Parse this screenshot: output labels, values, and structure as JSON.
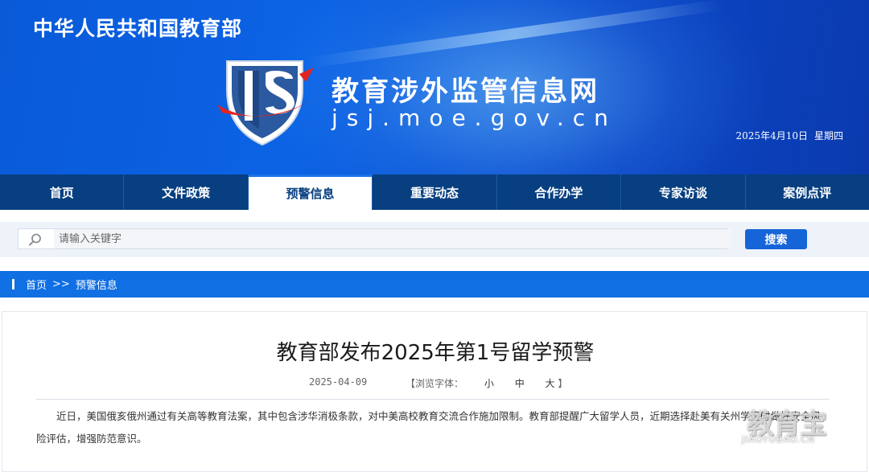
{
  "header": {
    "ministry": "中华人民共和国教育部",
    "site_title": "教育涉外监管信息网",
    "site_domain": "jsj.moe.gov.cn",
    "date": "2025年4月10日",
    "weekday": "星期四"
  },
  "nav": {
    "items": [
      {
        "label": "首页"
      },
      {
        "label": "文件政策"
      },
      {
        "label": "预警信息",
        "active": true
      },
      {
        "label": "重要动态"
      },
      {
        "label": "合作办学"
      },
      {
        "label": "专家访谈"
      },
      {
        "label": "案例点评"
      }
    ]
  },
  "search": {
    "placeholder": "请输入关键字",
    "value": "",
    "button_label": "搜索"
  },
  "breadcrumb": {
    "home": "首页",
    "separator": ">>",
    "current": "预警信息"
  },
  "article": {
    "title": "教育部发布2025年第1号留学预警",
    "date": "2025-04-09",
    "font_size_label": "【浏览字体：",
    "font_sizes": [
      "小",
      "中",
      "大"
    ],
    "font_size_close": "】",
    "body": "近日，美国俄亥俄州通过有关高等教育法案，其中包含涉华消极条款，对中美高校教育交流合作施加限制。教育部提醒广大留学人员，近期选择赴美有关州学习时做好安全风险评估，增强防范意识。"
  },
  "watermark": {
    "cn": "教育宝",
    "en": "JIAOYUBAO.CN"
  },
  "colors": {
    "banner_blue": "#0b5fe0",
    "nav_navy": "#073f80",
    "breadcrumb_blue": "#0f6fe3",
    "search_button": "#1564d8",
    "logo_red": "#e3241e"
  }
}
